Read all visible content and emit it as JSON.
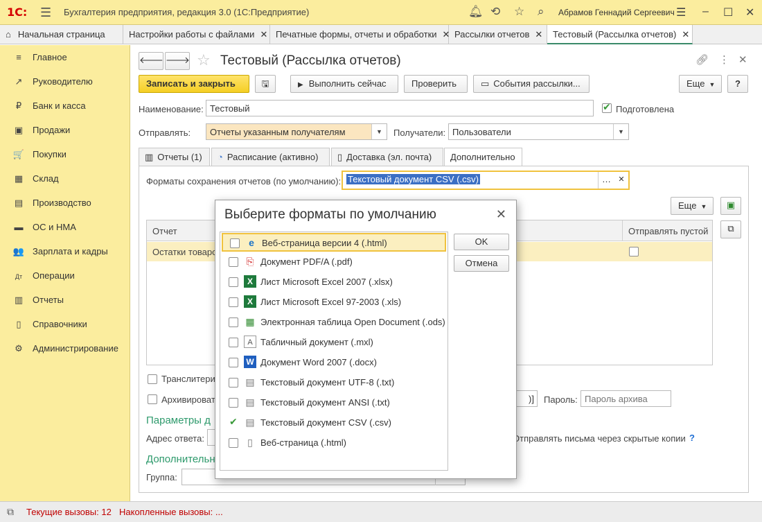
{
  "app": {
    "logo": "1С:",
    "title": "Бухгалтерия предприятия, редакция 3.0  (1С:Предприятие)",
    "user": "Абрамов Геннадий Сергеевич"
  },
  "open_tabs": [
    {
      "label": "Начальная страница"
    },
    {
      "label": "Настройки работы с файлами"
    },
    {
      "label": "Печатные формы, отчеты и обработки"
    },
    {
      "label": "Рассылки отчетов"
    },
    {
      "label": "Тестовый (Рассылка отчетов)"
    }
  ],
  "sidebar": {
    "items": [
      {
        "label": "Главное",
        "icon": "≡"
      },
      {
        "label": "Руководителю",
        "icon": "↗"
      },
      {
        "label": "Банк и касса",
        "icon": "₽"
      },
      {
        "label": "Продажи",
        "icon": "▣"
      },
      {
        "label": "Покупки",
        "icon": "🛒"
      },
      {
        "label": "Склад",
        "icon": "▦"
      },
      {
        "label": "Производство",
        "icon": "▤"
      },
      {
        "label": "ОС и НМА",
        "icon": "▬"
      },
      {
        "label": "Зарплата и кадры",
        "icon": "👥"
      },
      {
        "label": "Операции",
        "icon": "Дт"
      },
      {
        "label": "Отчеты",
        "icon": "▥"
      },
      {
        "label": "Справочники",
        "icon": "▯"
      },
      {
        "label": "Администрирование",
        "icon": "⚙"
      }
    ]
  },
  "form": {
    "title": "Тестовый (Рассылка отчетов)",
    "buttons": {
      "save_close": "Записать и закрыть",
      "run_now": "Выполнить сейчас",
      "check": "Проверить",
      "events": "События рассылки...",
      "more": "Еще",
      "help": "?"
    },
    "name_label": "Наименование:",
    "name_value": "Тестовый",
    "prepared_label": "Подготовлена",
    "send_label": "Отправлять:",
    "send_value": "Отчеты указанным получателям",
    "recipients_label": "Получатели:",
    "recipients_value": "Пользователи",
    "tabs": [
      {
        "label": "Отчеты (1)"
      },
      {
        "label": "Расписание (активно)"
      },
      {
        "label": "Доставка (эл. почта)"
      },
      {
        "label": "Дополнительно"
      }
    ],
    "formats_label": "Форматы сохранения отчетов (по умолчанию):",
    "formats_value": "Текстовый документ CSV (.csv)",
    "more_label": "Еще",
    "table": {
      "col_report": "Отчет",
      "col_send_empty": "Отправлять пустой",
      "row_report": "Остатки товаро"
    },
    "translit_label": "Транслитери",
    "archive_label": "Архивироват",
    "archive_name_fragment": ")]",
    "password_label": "Пароль:",
    "password_placeholder": "Пароль архива",
    "params_title": "Параметры д",
    "reply_label": "Адрес ответа:",
    "hidden_copies_label": "Отправлять письма через скрытые копии",
    "hidden_copies_help": "?",
    "extra_title": "Дополнительн",
    "group_label": "Группа:"
  },
  "dialog": {
    "title": "Выберите форматы по умолчанию",
    "ok": "OK",
    "cancel": "Отмена",
    "items": [
      {
        "label": "Веб-страница версии 4 (.html)",
        "checked": false,
        "icon": "e",
        "color": "#1a73c8"
      },
      {
        "label": "Документ PDF/A (.pdf)",
        "checked": false,
        "icon": "⎘",
        "color": "#d32f2f"
      },
      {
        "label": "Лист Microsoft Excel 2007 (.xlsx)",
        "checked": false,
        "icon": "X",
        "color": "#1e7a3c"
      },
      {
        "label": "Лист Microsoft Excel 97-2003 (.xls)",
        "checked": false,
        "icon": "X",
        "color": "#1e7a3c"
      },
      {
        "label": "Электронная таблица Open Document (.ods)",
        "checked": false,
        "icon": "▦",
        "color": "#2e8a2e"
      },
      {
        "label": "Табличный документ (.mxl)",
        "checked": false,
        "icon": "A",
        "color": "#555555"
      },
      {
        "label": "Документ Word 2007 (.docx)",
        "checked": false,
        "icon": "W",
        "color": "#1f5fbf"
      },
      {
        "label": "Текстовый документ UTF-8 (.txt)",
        "checked": false,
        "icon": "▤",
        "color": "#777777"
      },
      {
        "label": "Текстовый документ ANSI (.txt)",
        "checked": false,
        "icon": "▤",
        "color": "#777777"
      },
      {
        "label": "Текстовый документ CSV (.csv)",
        "checked": true,
        "icon": "▤",
        "color": "#777777"
      },
      {
        "label": "Веб-страница (.html)",
        "checked": false,
        "icon": "▯",
        "color": "#777777"
      }
    ]
  },
  "status": {
    "current_calls": "Текущие вызовы: 12",
    "accumulated_calls": "Накопленные вызовы: ..."
  },
  "colors": {
    "accent_yellow": "#fbed9e",
    "section_green": "#2e9a6c",
    "status_red": "#c00000"
  }
}
